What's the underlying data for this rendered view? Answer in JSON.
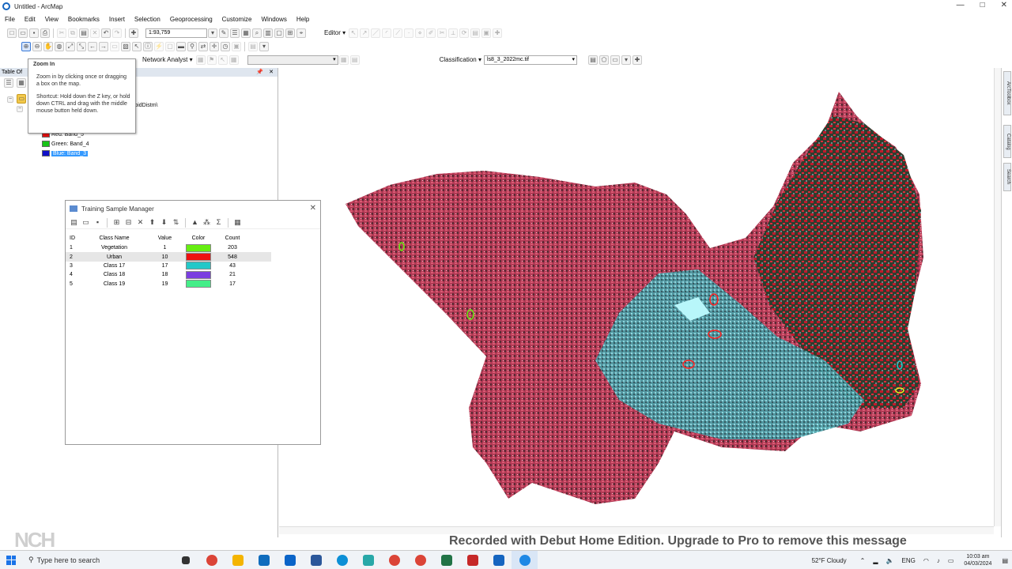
{
  "window": {
    "title": "Untitled - ArcMap",
    "controls": [
      "—",
      "□",
      "✕"
    ]
  },
  "menu": [
    "File",
    "Edit",
    "View",
    "Bookmarks",
    "Insert",
    "Selection",
    "Geoprocessing",
    "Customize",
    "Windows",
    "Help"
  ],
  "toolbar": {
    "scale": "1:93,759",
    "editor_label": "Editor ▾",
    "network_analyst_label": "Network Analyst ▾",
    "classification_label": "Classification ▾",
    "classification_layer": "ls8_3_2022mc.tif"
  },
  "toc": {
    "header_title": "Table Of",
    "layer_path": "rbidDistm\\",
    "bands": [
      {
        "label": "Red: Band_5",
        "color": "#e01010"
      },
      {
        "label": "Green: Band_4",
        "color": "#18c418"
      },
      {
        "label": "Blue: Band_3",
        "color": "#1010c8"
      }
    ]
  },
  "tooltip": {
    "title": "Zoom In",
    "description": "Zoom in by clicking once or dragging a box on the map.",
    "shortcut": "Shortcut: Hold down the Z key, or hold down CTRL and drag with the middle mouse button held down."
  },
  "training_sample_manager": {
    "title": "Training Sample Manager",
    "columns": {
      "id": "ID",
      "class_name": "Class Name",
      "value": "Value",
      "color": "Color",
      "count": "Count"
    },
    "rows": [
      {
        "id": "1",
        "class_name": "Vegetation",
        "value": "1",
        "color": "#66ee11",
        "count": "203"
      },
      {
        "id": "2",
        "class_name": "Urban",
        "value": "10",
        "color": "#ee1111",
        "count": "548"
      },
      {
        "id": "3",
        "class_name": "Class 17",
        "value": "17",
        "color": "#22c8c8",
        "count": "43"
      },
      {
        "id": "4",
        "class_name": "Class 18",
        "value": "18",
        "color": "#7a3ee0",
        "count": "21"
      },
      {
        "id": "5",
        "class_name": "Class 19",
        "value": "19",
        "color": "#44ee88",
        "count": "17"
      }
    ]
  },
  "right_dock": [
    "ArcToolbox",
    "Catalog",
    "Search"
  ],
  "watermark": "Recorded with Debut Home Edition. Upgrade to Pro to remove this message",
  "nch_logo": "NCH",
  "taskbar": {
    "search_placeholder": "Type here to search",
    "apps": [
      {
        "name": "task-view",
        "color": "#333333"
      },
      {
        "name": "chrome",
        "color": "#db4437"
      },
      {
        "name": "file-explorer",
        "color": "#f4b400"
      },
      {
        "name": "store",
        "color": "#0f6cbd"
      },
      {
        "name": "mail",
        "color": "#0a64c8"
      },
      {
        "name": "word",
        "color": "#2b579a"
      },
      {
        "name": "edge",
        "color": "#0c8fd6"
      },
      {
        "name": "app-teal",
        "color": "#28a8a8"
      },
      {
        "name": "chrome-2",
        "color": "#db4437"
      },
      {
        "name": "chrome-3",
        "color": "#db4437"
      },
      {
        "name": "excel",
        "color": "#217346"
      },
      {
        "name": "security",
        "color": "#c62828"
      },
      {
        "name": "arcmap",
        "color": "#1565c0"
      },
      {
        "name": "arcmap-active",
        "color": "#1e88e5"
      }
    ],
    "weather": "52°F  Cloudy",
    "lang": "ENG",
    "time": "10:03 am",
    "date": "04/03/2024"
  }
}
